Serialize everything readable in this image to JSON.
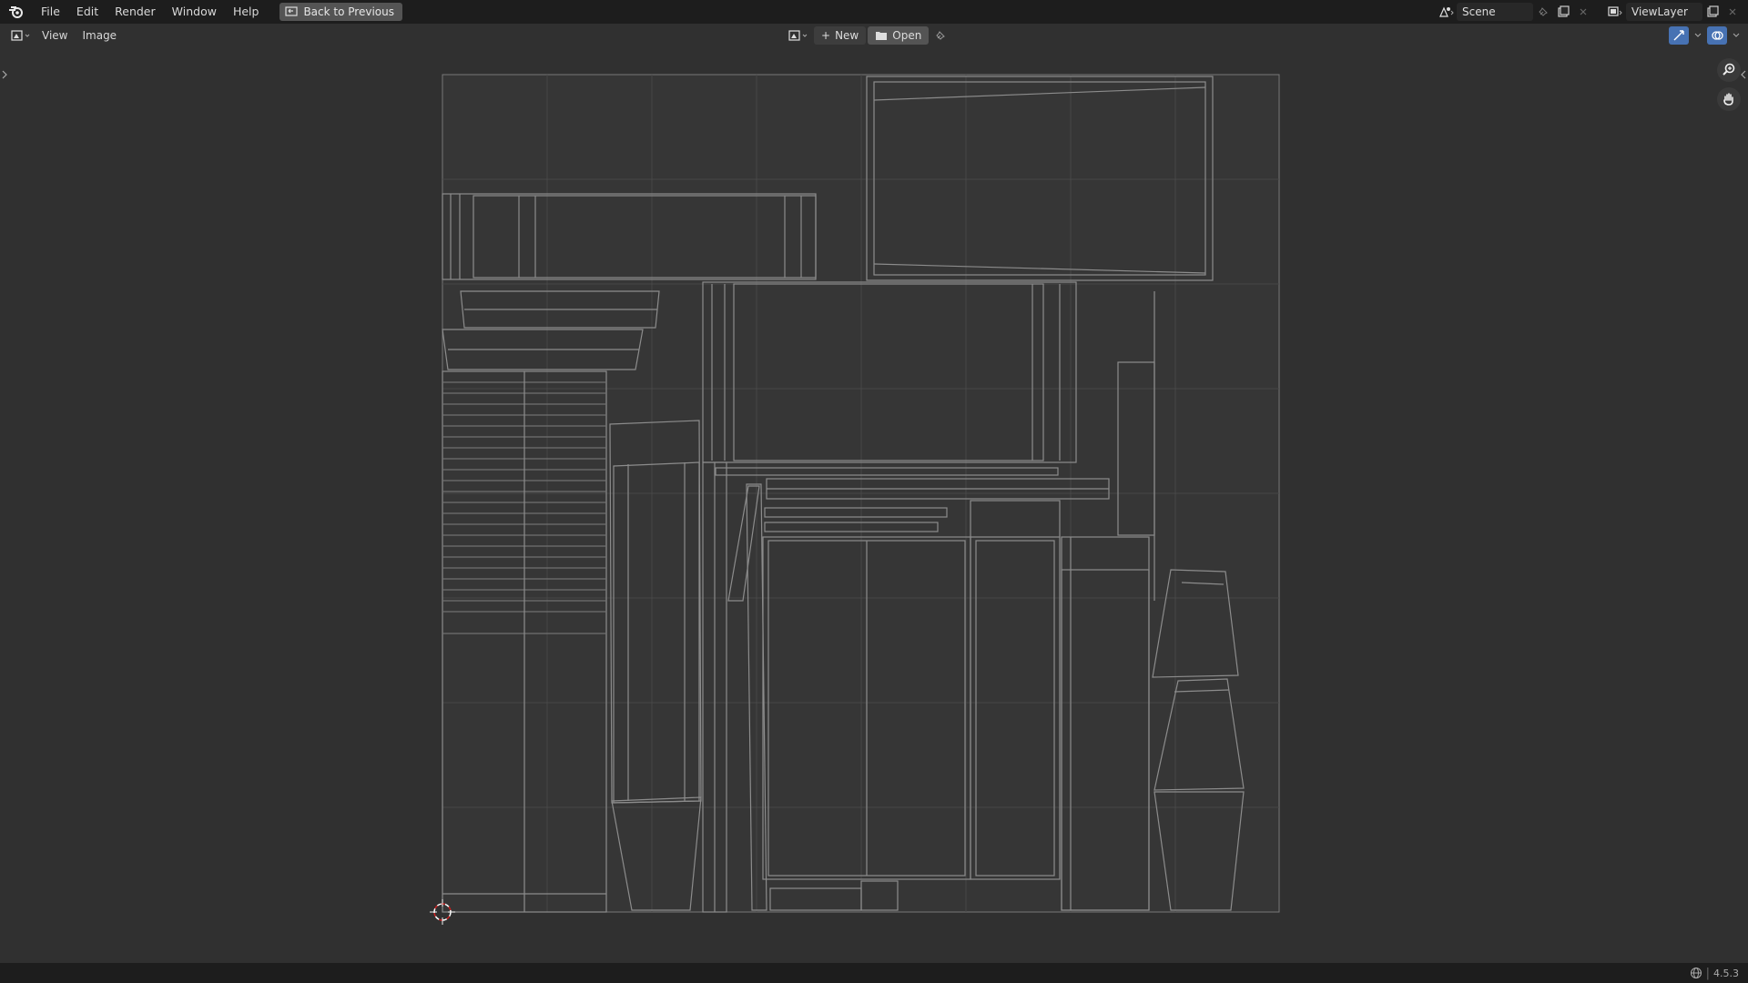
{
  "topbar": {
    "menus": [
      "File",
      "Edit",
      "Render",
      "Window",
      "Help"
    ],
    "back_label": "Back to Previous",
    "scene_value": "Scene",
    "viewlayer_value": "ViewLayer"
  },
  "editor_header": {
    "menus": [
      "View",
      "Image"
    ],
    "new_label": "New",
    "open_label": "Open"
  },
  "status": {
    "version": "4.5.3"
  },
  "colors": {
    "background": "#303030",
    "header": "#1d1d1d",
    "wire": "#8a8a8a",
    "accent": "#4772b3"
  },
  "icons": [
    "blender-logo-icon",
    "back-icon",
    "scene-icon",
    "pin-icon",
    "editor-type-icon",
    "image-browse-icon",
    "zoom-icon",
    "hand-pan-icon",
    "globe-icon"
  ]
}
